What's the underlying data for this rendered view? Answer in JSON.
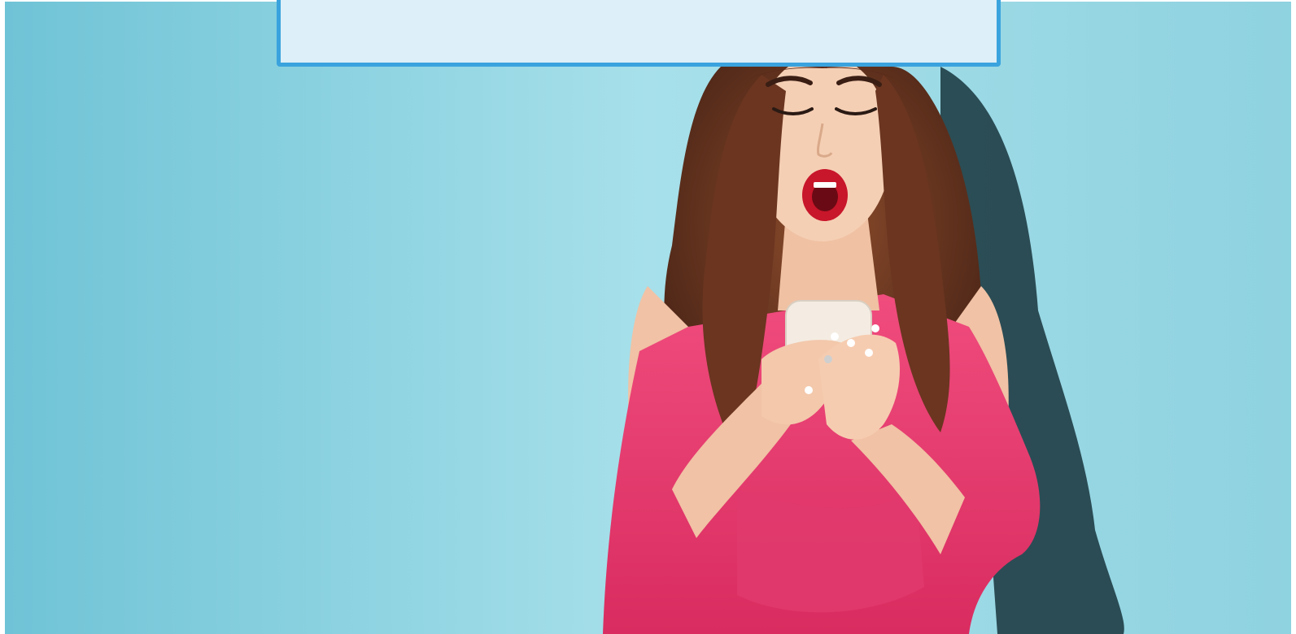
{
  "scene": {
    "caption": {
      "text": ""
    },
    "colors": {
      "background": "#9fdbe6",
      "caption_fill": "#ddeff8",
      "caption_border": "#3aa3de",
      "dress": "#ec3f73",
      "hair": "#7a4128",
      "skin": "#f2c7a9",
      "phone": "#f4ece2",
      "shadow": "#1f3d45"
    }
  }
}
